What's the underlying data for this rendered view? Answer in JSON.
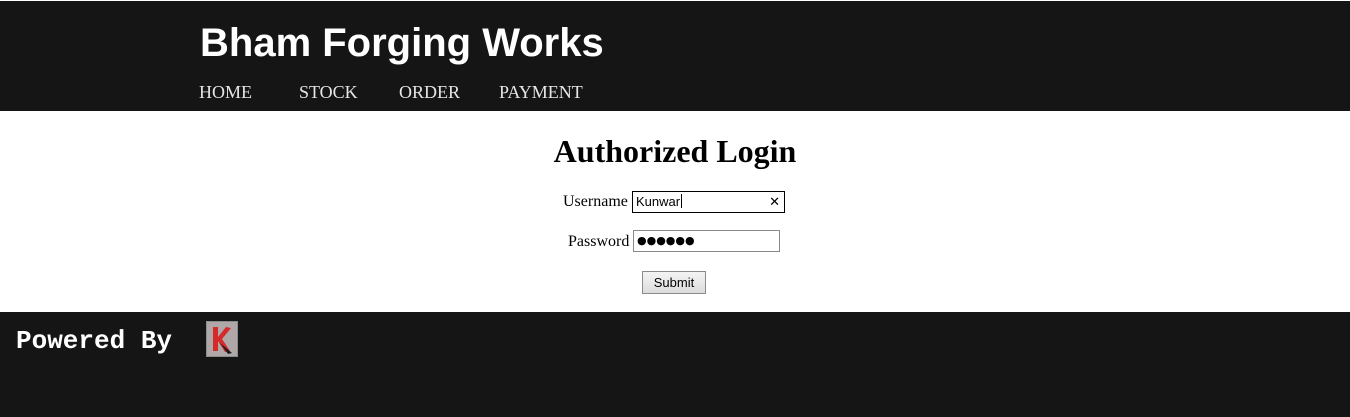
{
  "header": {
    "site_title": "Bham Forging Works",
    "nav": [
      {
        "label": "HOME"
      },
      {
        "label": "STOCK"
      },
      {
        "label": "ORDER"
      },
      {
        "label": "PAYMENT"
      }
    ]
  },
  "login": {
    "title": "Authorized Login",
    "username_label": "Username",
    "username_value": "Kunwar",
    "password_label": "Password",
    "password_masked": "●●●●●●",
    "submit_label": "Submit"
  },
  "footer": {
    "powered_by": "Powered By",
    "logo_icon": "k-logo-icon"
  },
  "colors": {
    "header_bg": "#151515",
    "footer_bg": "#151515",
    "logo_red": "#d42a2a"
  }
}
